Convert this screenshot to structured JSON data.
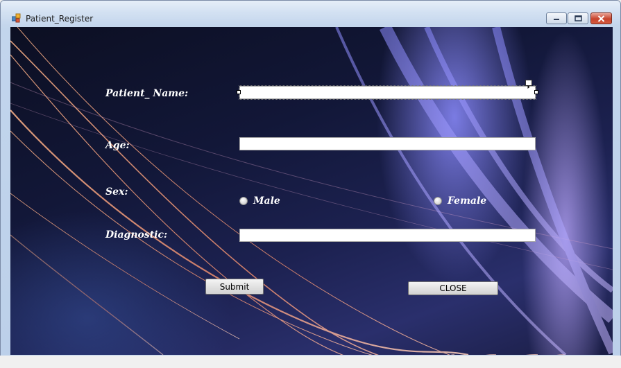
{
  "window": {
    "title": "Patient_Register",
    "icon": "form-app-icon",
    "controls": [
      "minimize-icon",
      "maximize-icon",
      "close-icon"
    ]
  },
  "form": {
    "patient_name_label": "Patient_ Name:",
    "patient_name_value": "",
    "age_label": "Age:",
    "age_value": "",
    "sex_label": "Sex:",
    "sex_options": [
      "Male",
      "Female"
    ],
    "diagnostic_label": "Diagnostic:",
    "diagnostic_value": "",
    "submit_label": "Submit",
    "close_label": "CLOSE"
  },
  "colors": {
    "label_text": "#ffffff",
    "close_button_red": "#c7432d"
  }
}
